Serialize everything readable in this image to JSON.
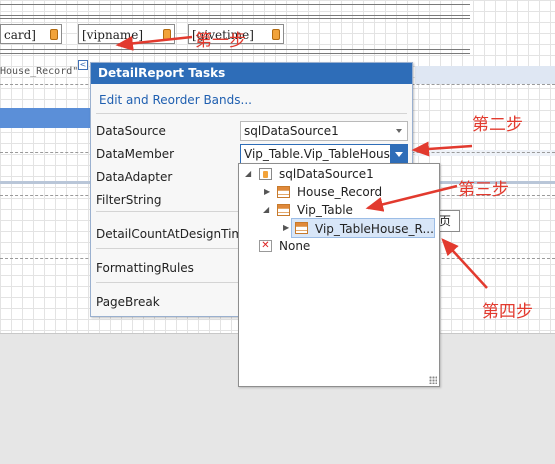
{
  "fields": [
    "card]",
    "[vipname]",
    "[givetime]"
  ],
  "band_tag": "House_Record\"",
  "smart_tag_icon": "<",
  "right_box_text": "页",
  "panel": {
    "title": "DetailReport Tasks",
    "link": "Edit and Reorder Bands...",
    "rows": [
      {
        "label": "DataSource",
        "value": "sqlDataSource1"
      },
      {
        "label": "DataMember",
        "value": "Vip_Table.Vip_TableHous"
      },
      {
        "label": "DataAdapter"
      },
      {
        "label": "FilterString"
      },
      {
        "label": "DetailCountAtDesignTime"
      },
      {
        "label": "FormattingRules"
      },
      {
        "label": "PageBreak"
      }
    ]
  },
  "tree": {
    "root": "sqlDataSource1",
    "house_record": "House_Record",
    "vip_table": "Vip_Table",
    "vip_table_house": "Vip_TableHouse_R...",
    "none": "None"
  },
  "annotations": {
    "step1": "第一步",
    "step2": "第二步",
    "step3": "第三步",
    "step4": "第四步"
  },
  "colors": {
    "header_blue": "#2e6db8",
    "annotation_red": "#e23a2e",
    "link_blue": "#1f5fb0"
  }
}
